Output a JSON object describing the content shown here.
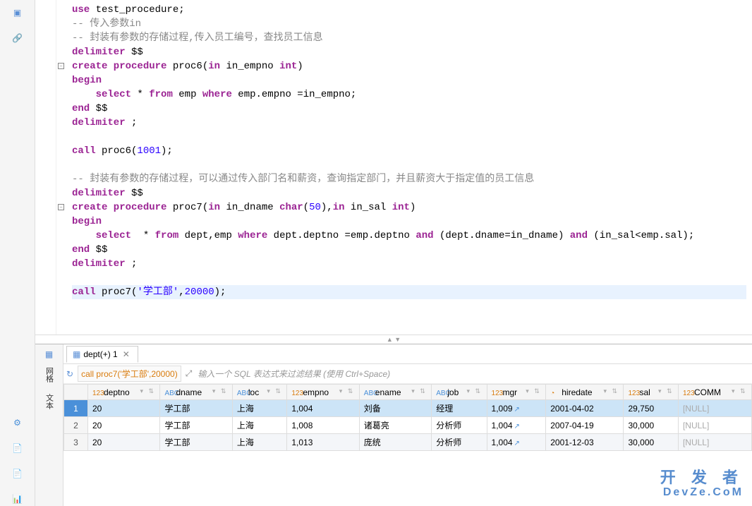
{
  "editor": {
    "lines": [
      {
        "t": "code",
        "seg": [
          {
            "c": "kw",
            "v": "use"
          },
          {
            "c": "",
            "v": " test_procedure;"
          }
        ]
      },
      {
        "t": "code",
        "seg": [
          {
            "c": "cm",
            "v": "-- 传入参数in"
          }
        ]
      },
      {
        "t": "code",
        "seg": [
          {
            "c": "cm",
            "v": "-- 封装有参数的存储过程,传入员工编号，查找员工信息"
          }
        ]
      },
      {
        "t": "code",
        "seg": [
          {
            "c": "kw",
            "v": "delimiter"
          },
          {
            "c": "",
            "v": " $$"
          }
        ]
      },
      {
        "t": "code",
        "fold": true,
        "seg": [
          {
            "c": "kw",
            "v": "create procedure"
          },
          {
            "c": "",
            "v": " proc6("
          },
          {
            "c": "kw",
            "v": "in"
          },
          {
            "c": "",
            "v": " in_empno "
          },
          {
            "c": "ty",
            "v": "int"
          },
          {
            "c": "",
            "v": ")"
          }
        ]
      },
      {
        "t": "code",
        "seg": [
          {
            "c": "kw",
            "v": "begin"
          }
        ]
      },
      {
        "t": "code",
        "seg": [
          {
            "c": "",
            "v": "    "
          },
          {
            "c": "kw",
            "v": "select"
          },
          {
            "c": "",
            "v": " * "
          },
          {
            "c": "kw",
            "v": "from"
          },
          {
            "c": "",
            "v": " emp "
          },
          {
            "c": "kw",
            "v": "where"
          },
          {
            "c": "",
            "v": " emp.empno =in_empno;"
          }
        ]
      },
      {
        "t": "code",
        "seg": [
          {
            "c": "kw",
            "v": "end"
          },
          {
            "c": "",
            "v": " $$"
          }
        ]
      },
      {
        "t": "code",
        "seg": [
          {
            "c": "kw",
            "v": "delimiter"
          },
          {
            "c": "",
            "v": " ;"
          }
        ]
      },
      {
        "t": "blank"
      },
      {
        "t": "code",
        "seg": [
          {
            "c": "kw",
            "v": "call"
          },
          {
            "c": "",
            "v": " proc6("
          },
          {
            "c": "num",
            "v": "1001"
          },
          {
            "c": "",
            "v": ");"
          }
        ]
      },
      {
        "t": "blank"
      },
      {
        "t": "code",
        "seg": [
          {
            "c": "cm",
            "v": "-- 封装有参数的存储过程，可以通过传入部门名和薪资，查询指定部门，并且薪资大于指定值的员工信息"
          }
        ]
      },
      {
        "t": "code",
        "seg": [
          {
            "c": "kw",
            "v": "delimiter"
          },
          {
            "c": "",
            "v": " $$"
          }
        ]
      },
      {
        "t": "code",
        "fold": true,
        "seg": [
          {
            "c": "kw",
            "v": "create procedure"
          },
          {
            "c": "",
            "v": " proc7("
          },
          {
            "c": "kw",
            "v": "in"
          },
          {
            "c": "",
            "v": " in_dname "
          },
          {
            "c": "ty",
            "v": "char"
          },
          {
            "c": "",
            "v": "("
          },
          {
            "c": "num",
            "v": "50"
          },
          {
            "c": "",
            "v": "),"
          },
          {
            "c": "kw",
            "v": "in"
          },
          {
            "c": "",
            "v": " in_sal "
          },
          {
            "c": "ty",
            "v": "int"
          },
          {
            "c": "",
            "v": ")"
          }
        ]
      },
      {
        "t": "code",
        "seg": [
          {
            "c": "kw",
            "v": "begin"
          }
        ]
      },
      {
        "t": "code",
        "seg": [
          {
            "c": "",
            "v": "    "
          },
          {
            "c": "kw",
            "v": "select"
          },
          {
            "c": "",
            "v": "  * "
          },
          {
            "c": "kw",
            "v": "from"
          },
          {
            "c": "",
            "v": " dept,emp "
          },
          {
            "c": "kw",
            "v": "where"
          },
          {
            "c": "",
            "v": " dept.deptno =emp.deptno "
          },
          {
            "c": "kw",
            "v": "and"
          },
          {
            "c": "",
            "v": " (dept.dname=in_dname) "
          },
          {
            "c": "kw",
            "v": "and"
          },
          {
            "c": "",
            "v": " (in_sal<emp.sal);"
          }
        ]
      },
      {
        "t": "code",
        "seg": [
          {
            "c": "kw",
            "v": "end"
          },
          {
            "c": "",
            "v": " $$"
          }
        ]
      },
      {
        "t": "code",
        "seg": [
          {
            "c": "kw",
            "v": "delimiter"
          },
          {
            "c": "",
            "v": " ;"
          }
        ]
      },
      {
        "t": "blank"
      },
      {
        "t": "code",
        "hl": true,
        "seg": [
          {
            "c": "kw",
            "v": "call"
          },
          {
            "c": "",
            "v": " proc7("
          },
          {
            "c": "str",
            "v": "'学工部'"
          },
          {
            "c": "",
            "v": ","
          },
          {
            "c": "num",
            "v": "20000"
          },
          {
            "c": "",
            "v": ");"
          }
        ]
      },
      {
        "t": "blank"
      }
    ]
  },
  "results": {
    "tab_label": "dept(+) 1",
    "call_label": "call proc7('学工部',20000)",
    "filter_placeholder": "输入一个 SQL 表达式来过滤结果 (使用 Ctrl+Space)",
    "columns": [
      {
        "name": "deptno",
        "type": "num"
      },
      {
        "name": "dname",
        "type": "txt"
      },
      {
        "name": "loc",
        "type": "txt"
      },
      {
        "name": "empno",
        "type": "num"
      },
      {
        "name": "ename",
        "type": "txt"
      },
      {
        "name": "job",
        "type": "txt"
      },
      {
        "name": "mgr",
        "type": "num",
        "link": true
      },
      {
        "name": "hiredate",
        "type": "date"
      },
      {
        "name": "sal",
        "type": "num"
      },
      {
        "name": "COMM",
        "type": "num"
      }
    ],
    "rows": [
      {
        "n": 1,
        "sel": true,
        "deptno": "20",
        "dname": "学工部",
        "loc": "上海",
        "empno": "1,004",
        "ename": "刘备",
        "job": "经理",
        "mgr": "1,009",
        "hiredate": "2001-04-02",
        "sal": "29,750",
        "COMM": "[NULL]"
      },
      {
        "n": 2,
        "deptno": "20",
        "dname": "学工部",
        "loc": "上海",
        "empno": "1,008",
        "ename": "诸葛亮",
        "job": "分析师",
        "mgr": "1,004",
        "hiredate": "2007-04-19",
        "sal": "30,000",
        "COMM": "[NULL]"
      },
      {
        "n": 3,
        "alt": true,
        "deptno": "20",
        "dname": "学工部",
        "loc": "上海",
        "empno": "1,013",
        "ename": "庞统",
        "job": "分析师",
        "mgr": "1,004",
        "hiredate": "2001-12-03",
        "sal": "30,000",
        "COMM": "[NULL]"
      }
    ],
    "side_tabs": {
      "grid": "网格",
      "text": "文本"
    }
  },
  "watermark": {
    "l1": "开 发 者",
    "l2": "DevZe.CoM"
  },
  "icons": {
    "console": "▣",
    "link": "🔗",
    "gear": "⚙",
    "doc1": "📄",
    "doc2": "📄",
    "doc3": "📊",
    "grid": "▦",
    "expand": "⤢",
    "refresh": "↻",
    "close": "✕",
    "ext": "↗"
  }
}
